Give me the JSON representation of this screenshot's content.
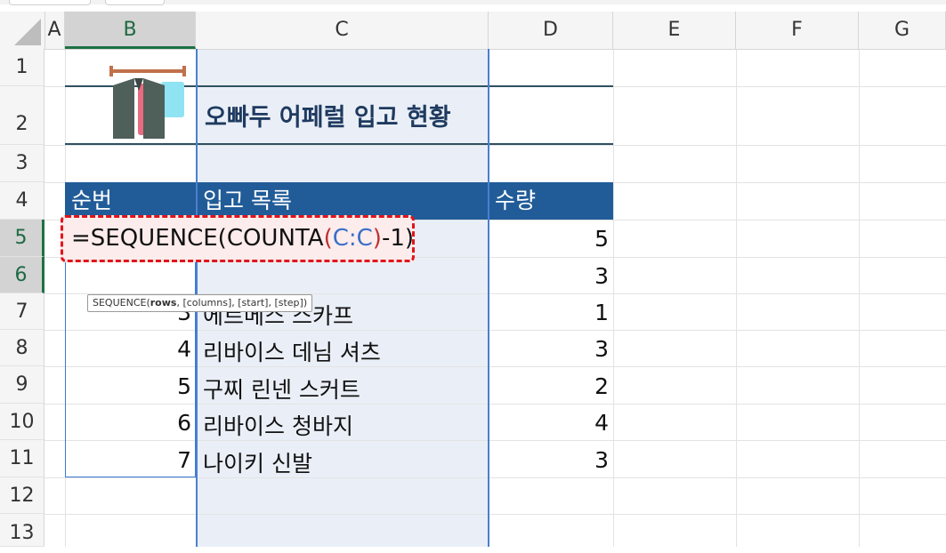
{
  "columns": [
    "A",
    "B",
    "C",
    "D",
    "E",
    "F",
    "G"
  ],
  "rows": [
    "1",
    "2",
    "3",
    "4",
    "5",
    "6",
    "7",
    "8",
    "9",
    "10",
    "11",
    "12",
    "13"
  ],
  "sheet": {
    "title": "오빠두 어페럴 입고 현황",
    "headers": {
      "b": "순번",
      "c": "입고 목록",
      "d": "수량"
    },
    "sequence": [
      "3",
      "4",
      "5",
      "6",
      "7"
    ],
    "items": [
      "에르메스 스카프",
      "리바이스 데님 셔츠",
      "구찌 린넨 스커트",
      "리바이스 청바지",
      "나이키 신발"
    ],
    "qty": [
      "5",
      "3",
      "1",
      "3",
      "2",
      "4",
      "3"
    ]
  },
  "formula": {
    "prefix": "=SEQUENCE(COUNTA",
    "open_paren": "(",
    "ref": "C:C",
    "close_paren": ")",
    "suffix": "-1)"
  },
  "tooltip": {
    "fn": "SEQUENCE(",
    "arg_current": "rows",
    "rest": ", [columns], [start], [step])"
  },
  "colors": {
    "header_fill": "#215c98",
    "title_text": "#1e3a5f",
    "highlight": "#e0151b",
    "selected_header": "#1e7145"
  }
}
